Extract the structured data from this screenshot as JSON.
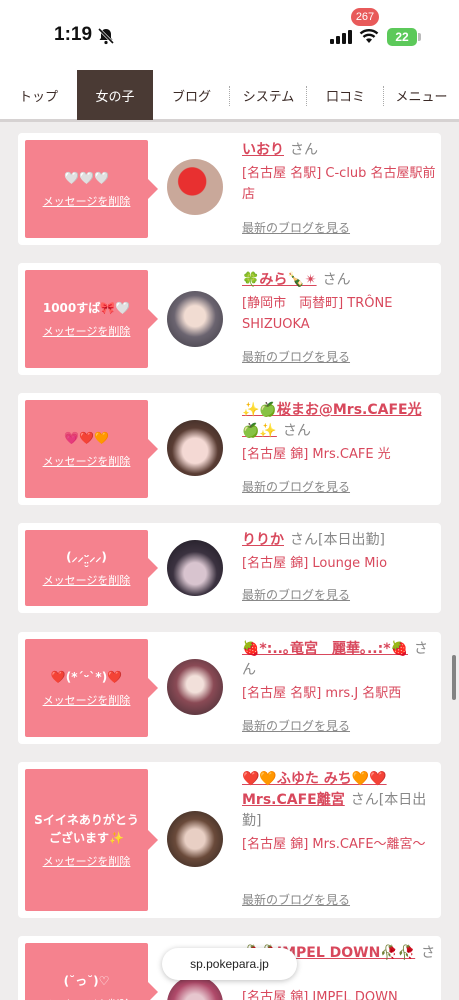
{
  "status_bar": {
    "time": "1:19",
    "battery": "22"
  },
  "nav": {
    "tabs": [
      {
        "label": "トップ",
        "active": false
      },
      {
        "label": "女の子",
        "active": true
      },
      {
        "label": "ブログ",
        "active": false
      },
      {
        "label": "システム",
        "active": false
      },
      {
        "label": "口コミ",
        "active": false
      },
      {
        "label": "メニュー",
        "active": false
      }
    ],
    "review_badge": "267"
  },
  "delete_label": "メッセージを削除",
  "blog_label": "最新のブログを見る",
  "cards": [
    {
      "message": "🤍🤍🤍",
      "name": "いおり",
      "san": "さん",
      "shop": "[名古屋 名駅] C-club 名古屋駅前店"
    },
    {
      "message": "1000すば🎀🤍",
      "name": "🍀みら🍾✴",
      "san": "さん",
      "shop": "[静岡市　両替町] TRÔNE SHIZUOKA"
    },
    {
      "message": "💗❤️🧡",
      "name": "✨🍏桜まお@Mrs.CAFE光🍏✨",
      "san": "さん",
      "shop": "[名古屋 錦] Mrs.CAFE 光"
    },
    {
      "message": "(⸝⸝ᵕ̤̮⸝⸝)",
      "name": "りりか",
      "san": "さん[本日出勤]",
      "shop": "[名古屋 錦] Lounge Mio"
    },
    {
      "message": "❤️(*ˊᵕˋ*)❤️",
      "name": "🍓*:..｡竜宮　麗華｡..:*🍓",
      "san": "さん",
      "shop": "[名古屋 名駅] mrs.J 名駅西"
    },
    {
      "message": "Sイイネありがとうございます✨",
      "name": "❤️🧡ふゆた みち🧡❤️ Mrs.CAFE離宮",
      "san": "さん[本日出勤]",
      "shop": "[名古屋 錦] Mrs.CAFE〜離宮〜"
    },
    {
      "message": "(˘っ˘)♡",
      "name": "🥀🥀IMPEL DOWN🥀🥀",
      "san": "さん",
      "shop": "[名古屋 錦] IMPEL DOWN"
    }
  ],
  "url_bar": {
    "host": "sp.pokepara.jp"
  },
  "colors": {
    "accent": "#d8485c",
    "message_bg": "#f5828e",
    "active_tab": "#4a3a34"
  }
}
